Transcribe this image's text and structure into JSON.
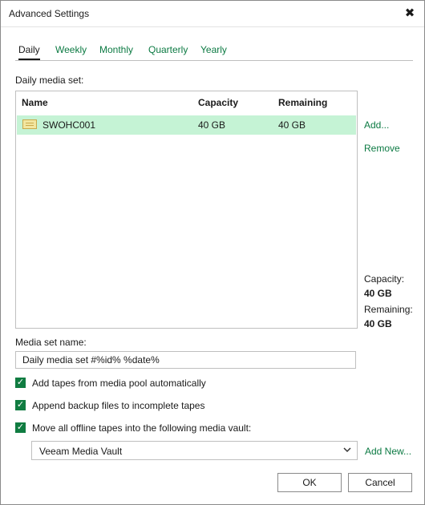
{
  "window": {
    "title": "Advanced Settings",
    "close_glyph": "✖"
  },
  "tabs": [
    {
      "label": "Daily",
      "active": true
    },
    {
      "label": "Weekly",
      "active": false
    },
    {
      "label": "Monthly",
      "active": false
    },
    {
      "label": "Quarterly",
      "active": false
    },
    {
      "label": "Yearly",
      "active": false
    }
  ],
  "media_set_list": {
    "label": "Daily media set:",
    "columns": [
      "Name",
      "Capacity",
      "Remaining"
    ],
    "rows": [
      {
        "icon": "tape-icon",
        "name": "SWOHC001",
        "capacity": "40 GB",
        "remaining": "40 GB",
        "selected": true
      }
    ],
    "selected_row_color": "#c5f3d5"
  },
  "side_actions": {
    "add": "Add...",
    "remove": "Remove"
  },
  "summary": {
    "capacity_label": "Capacity:",
    "capacity_value": "40 GB",
    "remaining_label": "Remaining:",
    "remaining_value": "40 GB"
  },
  "media_set_name": {
    "label": "Media set name:",
    "value": "Daily media set #%id% %date%"
  },
  "options": [
    {
      "label": "Add tapes from media pool automatically",
      "checked": true
    },
    {
      "label": "Append backup files to incomplete tapes",
      "checked": true
    },
    {
      "label": "Move all offline tapes into the following media vault:",
      "checked": true
    }
  ],
  "check_glyph": "✓",
  "vault": {
    "selected": "Veeam Media Vault",
    "add_new": "Add New..."
  },
  "buttons": {
    "ok": "OK",
    "cancel": "Cancel"
  },
  "colors": {
    "link": "#0c7a43",
    "checkbox": "#107c41",
    "selected_row": "#c5f3d5"
  }
}
